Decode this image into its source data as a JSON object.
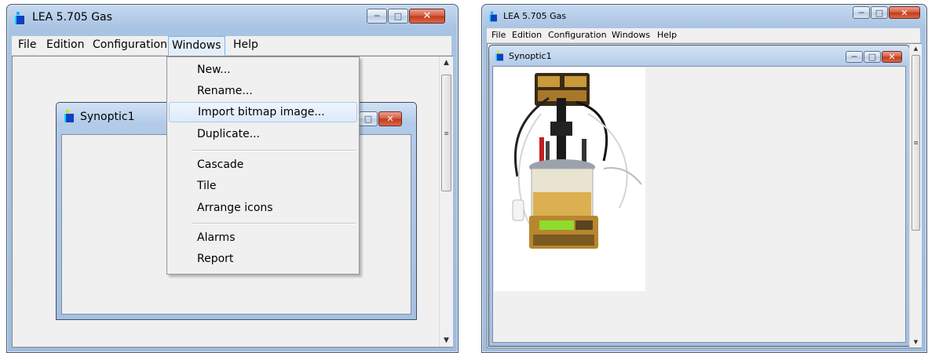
{
  "left_window": {
    "title": "LEA 5.705 Gas",
    "menu": [
      "File",
      "Edition",
      "Configuration",
      "Windows",
      "Help"
    ],
    "open_menu": "Windows",
    "dropdown_items": [
      "New...",
      "Rename...",
      "Import bitmap image...",
      "Duplicate...",
      "Cascade",
      "Tile",
      "Arrange icons",
      "Alarms",
      "Report"
    ],
    "highlighted_item": "Import bitmap image...",
    "child_title": "Synoptic1"
  },
  "right_window": {
    "title": "LEA 5.705 Gas",
    "menu": [
      "File",
      "Edition",
      "Configuration",
      "Windows",
      "Help"
    ],
    "child_title": "Synoptic1",
    "image_content": "bioreactor-photo",
    "display_screen_color": "#8fdc2c"
  },
  "colors": {
    "titlebar": "#a9c3e3",
    "close_button": "#c1391a",
    "client_background": "#f0f0f0",
    "menu_highlight_border": "#7eb4ea"
  },
  "icons": {
    "minimize": "minimize-icon",
    "maximize": "maximize-icon",
    "close": "close-icon",
    "app": "lea-app-icon",
    "scroll_up": "scroll-up-arrow-icon",
    "scroll_down": "scroll-down-arrow-icon"
  }
}
